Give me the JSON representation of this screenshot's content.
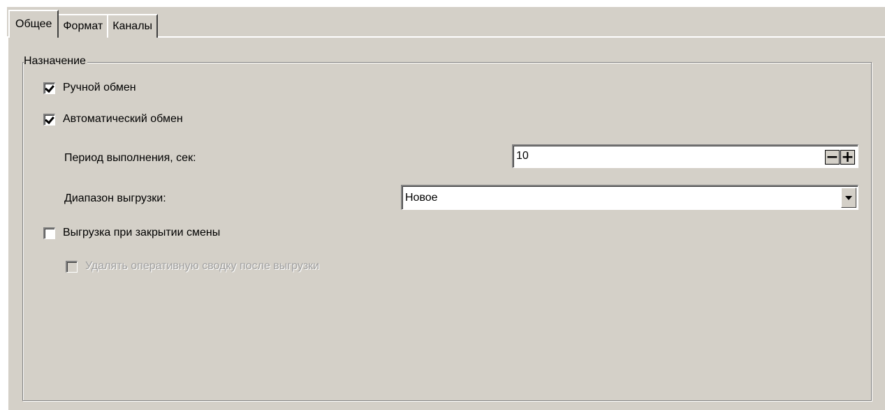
{
  "tabs": [
    {
      "label": "Общее",
      "active": true
    },
    {
      "label": "Формат",
      "active": false
    },
    {
      "label": "Каналы",
      "active": false
    }
  ],
  "group": {
    "title": "Назначение",
    "manual_exchange": {
      "label": "Ручной обмен",
      "checked": true
    },
    "auto_exchange": {
      "label": "Автоматический обмен",
      "checked": true
    },
    "period": {
      "label": "Период выполнения, сек:",
      "value": "10",
      "minus": "−",
      "plus": "+"
    },
    "range": {
      "label": "Диапазон выгрузки:",
      "value": "Новое"
    },
    "export_on_close": {
      "label": "Выгрузка при закрытии смены",
      "checked": false
    },
    "delete_summary": {
      "label": "Удалять оперативную сводку после выгрузки",
      "checked": false,
      "disabled": true
    }
  }
}
